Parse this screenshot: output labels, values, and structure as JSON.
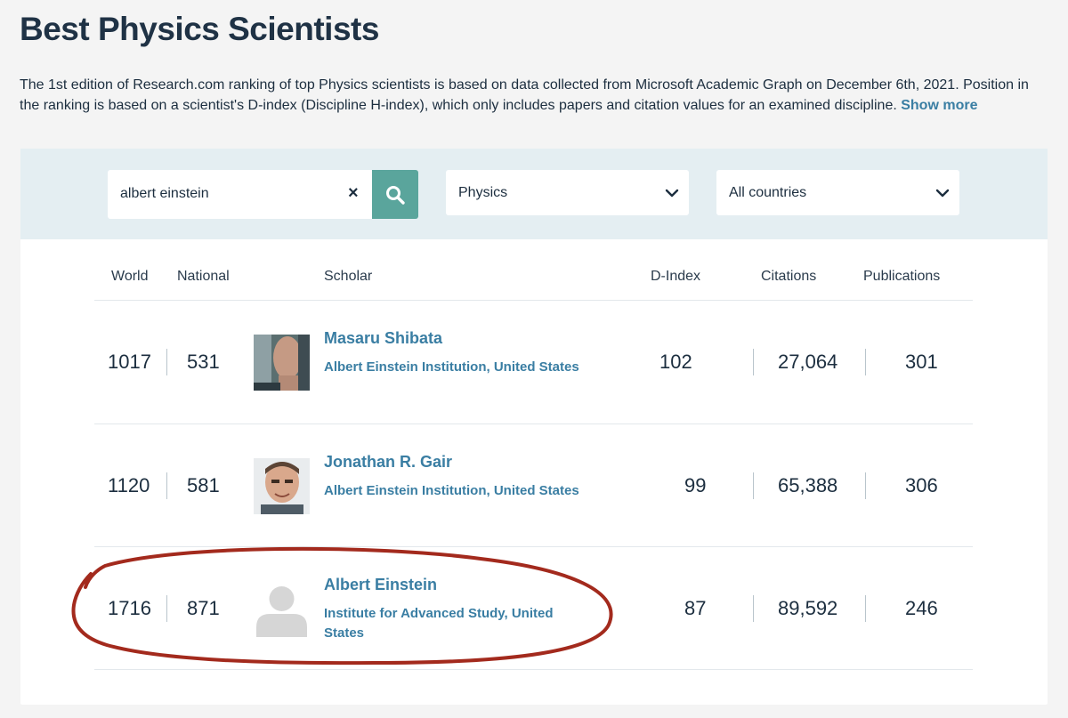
{
  "page": {
    "title": "Best Physics Scientists",
    "intro": "The 1st edition of Research.com ranking of top Physics scientists is based on data collected from Microsoft Academic Graph on December 6th, 2021. Position in the ranking is based on a scientist's D-index (Discipline H-index), which only includes papers and citation values for an examined discipline.",
    "show_more": "Show more"
  },
  "filters": {
    "search_value": "albert einstein",
    "clear_icon": "×",
    "discipline": "Physics",
    "country": "All countries"
  },
  "table": {
    "headers": {
      "world": "World",
      "national": "National",
      "scholar": "Scholar",
      "dindex": "D-Index",
      "citations": "Citations",
      "publications": "Publications"
    },
    "rows": [
      {
        "world": "1017",
        "national": "531",
        "name": "Masaru Shibata",
        "institution": "Albert Einstein Institution, United States",
        "dindex": "102",
        "citations": "27,064",
        "publications": "301",
        "avatar": "photo"
      },
      {
        "world": "1120",
        "national": "581",
        "name": "Jonathan R. Gair",
        "institution": "Albert Einstein Institution, United States",
        "dindex": "99",
        "citations": "65,388",
        "publications": "306",
        "avatar": "photo"
      },
      {
        "world": "1716",
        "national": "871",
        "name": "Albert Einstein",
        "institution": "Institute for Advanced Study, United States",
        "dindex": "87",
        "citations": "89,592",
        "publications": "246",
        "avatar": "placeholder"
      }
    ]
  },
  "colors": {
    "accent": "#3a7ea3",
    "search_button": "#5aa59c",
    "filter_bar": "#e4eef2",
    "annotation": "#a32a1d"
  },
  "icons": {
    "search": "search-icon",
    "chevron": "chevron-down-icon",
    "clear": "close-icon",
    "avatar_placeholder": "user-placeholder-icon"
  }
}
